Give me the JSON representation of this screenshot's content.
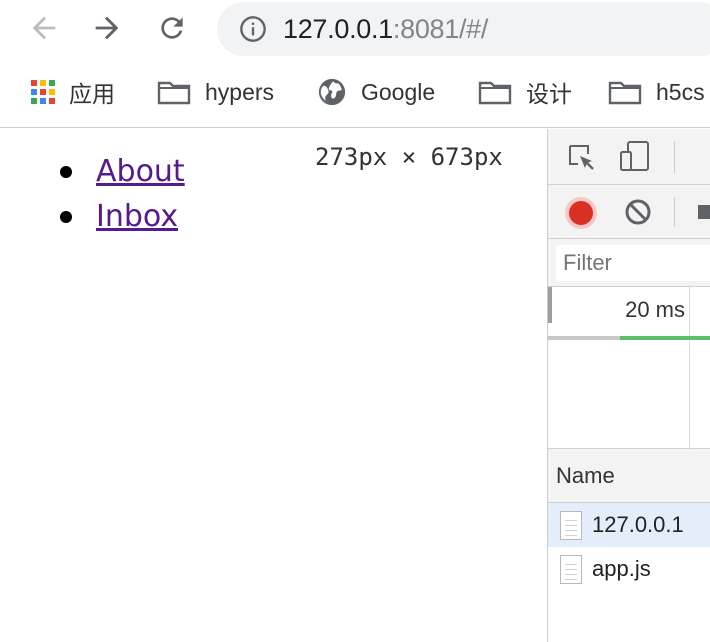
{
  "browser": {
    "url_host": "127.0.0.1",
    "url_rest": ":8081/#/"
  },
  "bookmarks": [
    {
      "label": "应用",
      "icon": "apps-grid-icon"
    },
    {
      "label": "hypers",
      "icon": "folder-icon"
    },
    {
      "label": "Google",
      "icon": "globe-icon"
    },
    {
      "label": "设计",
      "icon": "folder-icon"
    },
    {
      "label": "h5cs",
      "icon": "folder-icon"
    }
  ],
  "page": {
    "links": [
      "About",
      "Inbox"
    ],
    "viewport_dims": "273px × 673px"
  },
  "devtools": {
    "filter_placeholder": "Filter",
    "timeline_label": "20 ms",
    "table_header": "Name",
    "requests": [
      "127.0.0.1",
      "app.js"
    ]
  },
  "colors": {
    "record": "#d93025",
    "link": "#551a8b",
    "selected_row": "#e4eefa",
    "waterfall_green": "#5fbf67"
  }
}
